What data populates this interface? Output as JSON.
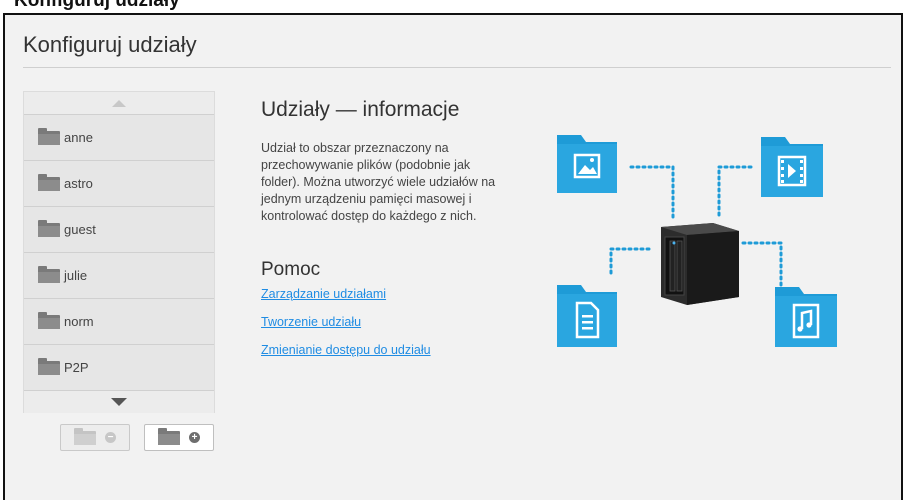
{
  "caption": "Konfiguruj udziały",
  "page": {
    "title": "Konfiguruj udziały"
  },
  "shares": {
    "items": [
      {
        "label": "anne"
      },
      {
        "label": "astro"
      },
      {
        "label": "guest"
      },
      {
        "label": "julie"
      },
      {
        "label": "norm"
      },
      {
        "label": "P2P"
      }
    ]
  },
  "info": {
    "title": "Udziały — informacje",
    "text": "Udział to obszar przeznaczony na przechowywanie plików (podobnie jak folder). Można utworzyć wiele udziałów na jednym urządzeniu pamięci masowej i kontrolować dostęp do każdego z nich."
  },
  "help": {
    "title": "Pomoc",
    "links": [
      {
        "label": "Zarządzanie udziałami"
      },
      {
        "label": "Tworzenie udziału"
      },
      {
        "label": "Zmienianie dostępu do udziału"
      }
    ]
  },
  "colors": {
    "accent": "#1f8ce3",
    "folder_blue": "#1e9bd7",
    "nas_body": "#1d1d1d"
  }
}
